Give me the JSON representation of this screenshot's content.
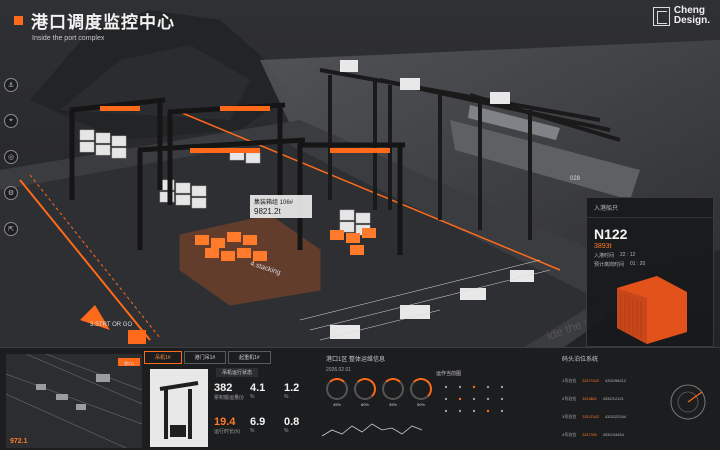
{
  "header": {
    "title": "港口调度监控中心",
    "subtitle": "Inside the port complex",
    "logo_line1": "Cheng",
    "logo_line2": "Design."
  },
  "side_nav": [
    {
      "icon": "anchor-icon",
      "glyph": "⚓"
    },
    {
      "icon": "target-icon",
      "glyph": "⌖"
    },
    {
      "icon": "radar-icon",
      "glyph": "◎"
    },
    {
      "icon": "settings-icon",
      "glyph": "⚙"
    },
    {
      "icon": "exit-icon",
      "glyph": "⇱"
    }
  ],
  "tooltip": {
    "label": "集装箱组 106#",
    "value": "9821.2t"
  },
  "scene_labels": {
    "stacking": "4.stacking",
    "start": "3.STRT OR GO",
    "ship_no": "028",
    "watermark": "ide the port"
  },
  "ship_card": {
    "header": "入港船只",
    "id": "N122",
    "subtitle": "3893t",
    "line1_label": "入港时间",
    "line1_value": "22 : 12",
    "line2_label": "预计离岗时间",
    "line2_value": "01 : 20"
  },
  "bottom": {
    "map_tag": "港口1",
    "map_value": "972.1",
    "tabs": [
      {
        "label": "吊机1#",
        "active": true
      },
      {
        "label": "港门吊1#",
        "active": false
      },
      {
        "label": "起重机1#",
        "active": false
      }
    ],
    "equip_label": "吊机运行状态",
    "stats": [
      {
        "num": "382",
        "unit": "累积搬运量(t)",
        "orange": false
      },
      {
        "num": "4.1",
        "unit": "%",
        "orange": false
      },
      {
        "num": "1.2",
        "unit": "%",
        "orange": false
      },
      {
        "num": "19.4",
        "unit": "运行时长(h)",
        "orange": true
      },
      {
        "num": "6.9",
        "unit": "%",
        "orange": false
      },
      {
        "num": "0.8",
        "unit": "%",
        "orange": false
      }
    ],
    "gauge_panel": {
      "title": "港口1区 整体运维信息",
      "time": "2026.02.01",
      "gauges": [
        "45%",
        "80%",
        "35%",
        "50%"
      ],
      "chart_title": "运作当前图"
    },
    "berth_panel": {
      "title": "码头泊位系统",
      "rows": [
        {
          "name": "1号泊位",
          "o": "321/7342",
          "v": "4332/98212"
        },
        {
          "name": "2号泊位",
          "o": "321/862",
          "v": "4332/12121"
        },
        {
          "name": "3号泊位",
          "o": "321/2342",
          "v": "4332/22344"
        },
        {
          "name": "4号泊位",
          "o": "321/765",
          "v": "4332/43454"
        }
      ]
    }
  },
  "colors": {
    "accent": "#ff6a1a",
    "bg": "#1b1c1e"
  }
}
